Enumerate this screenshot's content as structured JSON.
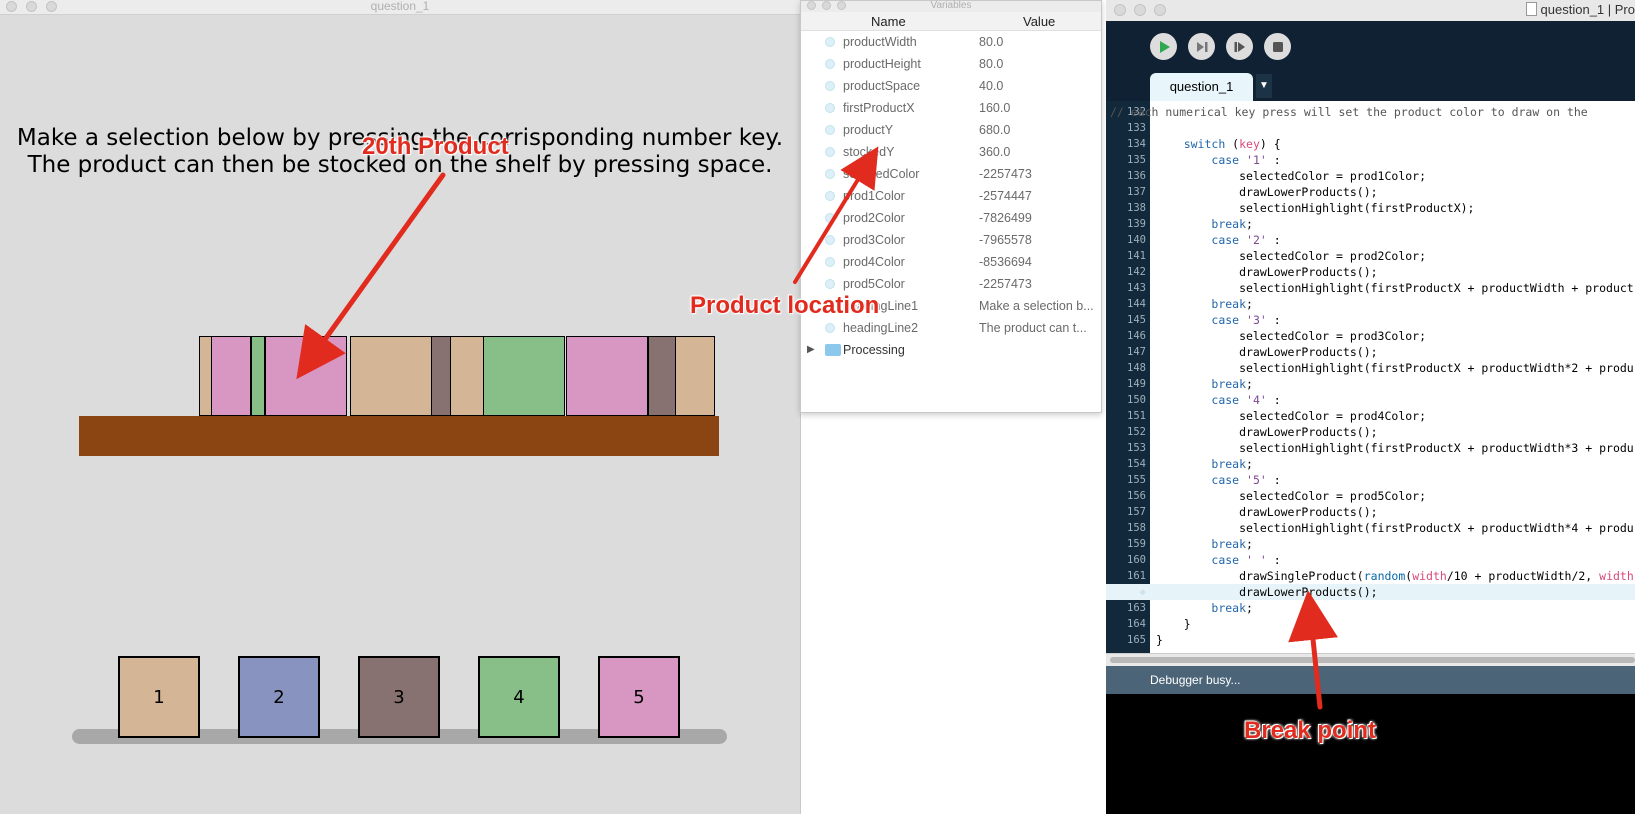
{
  "sketch": {
    "window_title": "question_1",
    "heading_line1": "Make a selection below by pressing the corrisponding number key.",
    "heading_line2": "The product can then be stocked on the shelf by pressing space.",
    "shelf_color": "#8b4513",
    "stocked_products": [
      {
        "color": "#d4b596"
      },
      {
        "color": "#d896c2"
      },
      {
        "color": "#88be88"
      },
      {
        "color": "#d896c2"
      },
      {
        "color": "#d4b596"
      },
      {
        "color": "#877271"
      },
      {
        "color": "#d4b596"
      },
      {
        "color": "#88be88"
      },
      {
        "color": "#d896c2"
      },
      {
        "color": "#877271"
      },
      {
        "color": "#d4b596"
      }
    ],
    "lower_products": [
      {
        "label": "1",
        "color": "#d4b596"
      },
      {
        "label": "2",
        "color": "#8893bf"
      },
      {
        "label": "3",
        "color": "#877271"
      },
      {
        "label": "4",
        "color": "#88be88"
      },
      {
        "label": "5",
        "color": "#d896c2"
      }
    ]
  },
  "variables": {
    "window_title": "Variables",
    "col_name": "Name",
    "col_value": "Value",
    "rows": [
      {
        "name": "productWidth",
        "value": "80.0"
      },
      {
        "name": "productHeight",
        "value": "80.0"
      },
      {
        "name": "productSpace",
        "value": "40.0"
      },
      {
        "name": "firstProductX",
        "value": "160.0"
      },
      {
        "name": "productY",
        "value": "680.0"
      },
      {
        "name": "stockedY",
        "value": "360.0"
      },
      {
        "name": "selectedColor",
        "value": "-2257473"
      },
      {
        "name": "prod1Color",
        "value": "-2574447"
      },
      {
        "name": "prod2Color",
        "value": "-7826499"
      },
      {
        "name": "prod3Color",
        "value": "-7965578"
      },
      {
        "name": "prod4Color",
        "value": "-8536694"
      },
      {
        "name": "prod5Color",
        "value": "-2257473"
      },
      {
        "name": "headingLine1",
        "value": "Make a selection b..."
      },
      {
        "name": "headingLine2",
        "value": "The product can t..."
      }
    ],
    "folder": "Processing"
  },
  "ide": {
    "title": "question_1 | Pro",
    "tab": "question_1",
    "status": "Debugger busy...",
    "breakpoint_marker": "◆",
    "lines": [
      {
        "n": "132",
        "segs": [
          [
            "c",
            "// each numerical key press will set the product color to draw on the"
          ]
        ]
      },
      {
        "n": "133",
        "segs": [
          [
            "t",
            ""
          ]
        ]
      },
      {
        "n": "134",
        "segs": [
          [
            "t",
            "    "
          ],
          [
            "kw",
            "switch"
          ],
          [
            "t",
            " ("
          ],
          [
            "varc",
            "key"
          ],
          [
            "t",
            ") {"
          ]
        ]
      },
      {
        "n": "135",
        "segs": [
          [
            "t",
            "        "
          ],
          [
            "kw",
            "case"
          ],
          [
            "t",
            " "
          ],
          [
            "str",
            "'1'"
          ],
          [
            "t",
            " :"
          ]
        ]
      },
      {
        "n": "136",
        "segs": [
          [
            "t",
            "            selectedColor = prod1Color;"
          ]
        ]
      },
      {
        "n": "137",
        "segs": [
          [
            "t",
            "            drawLowerProducts();"
          ]
        ]
      },
      {
        "n": "138",
        "segs": [
          [
            "t",
            "            selectionHighlight(firstProductX);"
          ]
        ]
      },
      {
        "n": "139",
        "segs": [
          [
            "t",
            "        "
          ],
          [
            "kw",
            "break"
          ],
          [
            "t",
            ";"
          ]
        ]
      },
      {
        "n": "140",
        "segs": [
          [
            "t",
            "        "
          ],
          [
            "kw",
            "case"
          ],
          [
            "t",
            " "
          ],
          [
            "str",
            "'2'"
          ],
          [
            "t",
            " :"
          ]
        ]
      },
      {
        "n": "141",
        "segs": [
          [
            "t",
            "            selectedColor = prod2Color;"
          ]
        ]
      },
      {
        "n": "142",
        "segs": [
          [
            "t",
            "            drawLowerProducts();"
          ]
        ]
      },
      {
        "n": "143",
        "segs": [
          [
            "t",
            "            selectionHighlight(firstProductX + productWidth + product"
          ]
        ]
      },
      {
        "n": "144",
        "segs": [
          [
            "t",
            "        "
          ],
          [
            "kw",
            "break"
          ],
          [
            "t",
            ";"
          ]
        ]
      },
      {
        "n": "145",
        "segs": [
          [
            "t",
            "        "
          ],
          [
            "kw",
            "case"
          ],
          [
            "t",
            " "
          ],
          [
            "str",
            "'3'"
          ],
          [
            "t",
            " :"
          ]
        ]
      },
      {
        "n": "146",
        "segs": [
          [
            "t",
            "            selectedColor = prod3Color;"
          ]
        ]
      },
      {
        "n": "147",
        "segs": [
          [
            "t",
            "            drawLowerProducts();"
          ]
        ]
      },
      {
        "n": "148",
        "segs": [
          [
            "t",
            "            selectionHighlight(firstProductX + productWidth*2 + produ"
          ]
        ]
      },
      {
        "n": "149",
        "segs": [
          [
            "t",
            "        "
          ],
          [
            "kw",
            "break"
          ],
          [
            "t",
            ";"
          ]
        ]
      },
      {
        "n": "150",
        "segs": [
          [
            "t",
            "        "
          ],
          [
            "kw",
            "case"
          ],
          [
            "t",
            " "
          ],
          [
            "str",
            "'4'"
          ],
          [
            "t",
            " :"
          ]
        ]
      },
      {
        "n": "151",
        "segs": [
          [
            "t",
            "            selectedColor = prod4Color;"
          ]
        ]
      },
      {
        "n": "152",
        "segs": [
          [
            "t",
            "            drawLowerProducts();"
          ]
        ]
      },
      {
        "n": "153",
        "segs": [
          [
            "t",
            "            selectionHighlight(firstProductX + productWidth*3 + produ"
          ]
        ]
      },
      {
        "n": "154",
        "segs": [
          [
            "t",
            "        "
          ],
          [
            "kw",
            "break"
          ],
          [
            "t",
            ";"
          ]
        ]
      },
      {
        "n": "155",
        "segs": [
          [
            "t",
            "        "
          ],
          [
            "kw",
            "case"
          ],
          [
            "t",
            " "
          ],
          [
            "str",
            "'5'"
          ],
          [
            "t",
            " :"
          ]
        ]
      },
      {
        "n": "156",
        "segs": [
          [
            "t",
            "            selectedColor = prod5Color;"
          ]
        ]
      },
      {
        "n": "157",
        "segs": [
          [
            "t",
            "            drawLowerProducts();"
          ]
        ]
      },
      {
        "n": "158",
        "segs": [
          [
            "t",
            "            selectionHighlight(firstProductX + productWidth*4 + produ"
          ]
        ]
      },
      {
        "n": "159",
        "segs": [
          [
            "t",
            "        "
          ],
          [
            "kw",
            "break"
          ],
          [
            "t",
            ";"
          ]
        ]
      },
      {
        "n": "160",
        "segs": [
          [
            "t",
            "        "
          ],
          [
            "kw",
            "case"
          ],
          [
            "t",
            " "
          ],
          [
            "str",
            "' '"
          ],
          [
            "t",
            " :"
          ]
        ]
      },
      {
        "n": "161",
        "segs": [
          [
            "t",
            "            drawSingleProduct("
          ],
          [
            "fn",
            "random"
          ],
          [
            "t",
            "("
          ],
          [
            "varc",
            "width"
          ],
          [
            "t",
            "/10 + productWidth/2, "
          ],
          [
            "varc",
            "width"
          ]
        ]
      },
      {
        "n": "◆",
        "bp": true,
        "segs": [
          [
            "t",
            "            drawLowerProducts();"
          ]
        ]
      },
      {
        "n": "163",
        "segs": [
          [
            "t",
            "        "
          ],
          [
            "kw",
            "break"
          ],
          [
            "t",
            ";"
          ]
        ]
      },
      {
        "n": "164",
        "segs": [
          [
            "t",
            "    }"
          ]
        ]
      },
      {
        "n": "165",
        "segs": [
          [
            "t",
            "}"
          ]
        ]
      }
    ]
  },
  "annotations": {
    "product": "20th Product",
    "location": "Product location",
    "breakpoint": "Break point",
    "color": "#e12b1e"
  }
}
